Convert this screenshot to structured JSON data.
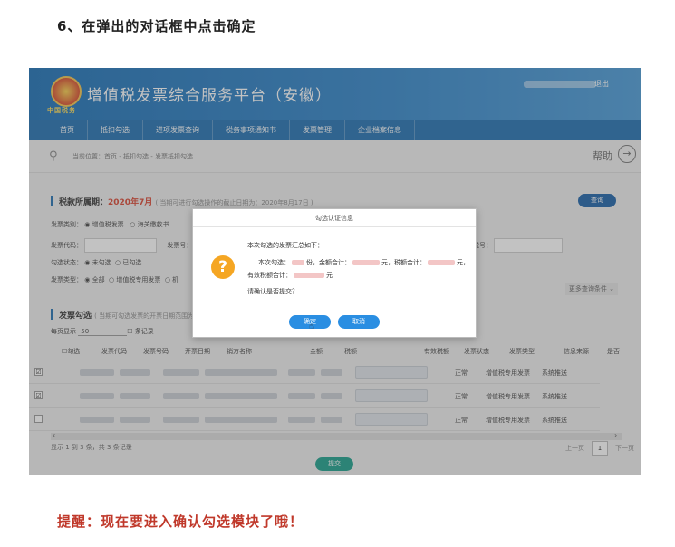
{
  "step_title": "6、在弹出的对话框中点击确定",
  "reminder": "提醒：现在要进入确认勾选模块了哦！",
  "header": {
    "emblem_text": "中国税务",
    "platform_name": "增值税发票综合服务平台（安徽）",
    "logout": "退出"
  },
  "nav": [
    "首页",
    "抵扣勾选",
    "进项发票查询",
    "税务事项通知书",
    "发票管理",
    "企业档案信息"
  ],
  "breadcrumb": {
    "text": "当前位置：首页 - 抵扣勾选 - 发票抵扣勾选",
    "help": "帮助",
    "help_arrow": "→"
  },
  "period": {
    "label": "税款所属期：",
    "value": "2020年7月",
    "note": "( 当期可进行勾选操作的截止日期为：2020年8月17日 )"
  },
  "query_button": "查询",
  "filters": {
    "invoice_category_label": "发票类别：",
    "opt_vat_invoice": "增值税发票",
    "opt_customs": "海关缴款书",
    "invoice_code_label": "发票代码：",
    "invoice_number_label": "发票号：",
    "tax_id_label": "税号：",
    "check_status_label": "勾选状态：",
    "opt_unchecked": "未勾选",
    "opt_checked": "已勾选",
    "invoice_type_label": "发票类型：",
    "opt_all": "全部",
    "opt_special": "增值税专用发票",
    "opt_more": "机",
    "more_conditions": "更多查询条件"
  },
  "list_section": {
    "title": "发票勾选",
    "note": "( 当期可勾选发票的开票日期范围为",
    "per_page_label": "每页显示",
    "per_page_value": "50",
    "records_label": "条记录"
  },
  "table": {
    "headers": [
      "勾选",
      "发票代码",
      "发票号码",
      "开票日期",
      "销方名称",
      "金额",
      "税额",
      "有效税额",
      "发票状态",
      "发票类型",
      "信息来源",
      "是否"
    ],
    "rows": [
      {
        "checked": "☑",
        "status": "正常",
        "type": "增值税专用发票",
        "source": "系统推送"
      },
      {
        "checked": "☑",
        "status": "正常",
        "type": "增值税专用发票",
        "source": "系统推送"
      },
      {
        "checked": "",
        "status": "正常",
        "type": "增值税专用发票",
        "source": "系统推送"
      }
    ]
  },
  "footer": {
    "summary": "显示 1 到 3 条，共 3 条记录",
    "prev": "上一页",
    "page": "1",
    "next": "下一页",
    "submit": "提交"
  },
  "dialog": {
    "title": "勾选认证信息",
    "icon_glyph": "?",
    "line1": "本次勾选的发票汇总如下：",
    "line2_a": "本次勾选：",
    "line2_b": "份，金额合计：",
    "line2_c": "元，税额合计：",
    "line2_d": "元，",
    "line3_a": "有效税额合计：",
    "line3_b": "元",
    "question": "请确认是否提交？",
    "confirm": "确定",
    "cancel": "取消"
  }
}
